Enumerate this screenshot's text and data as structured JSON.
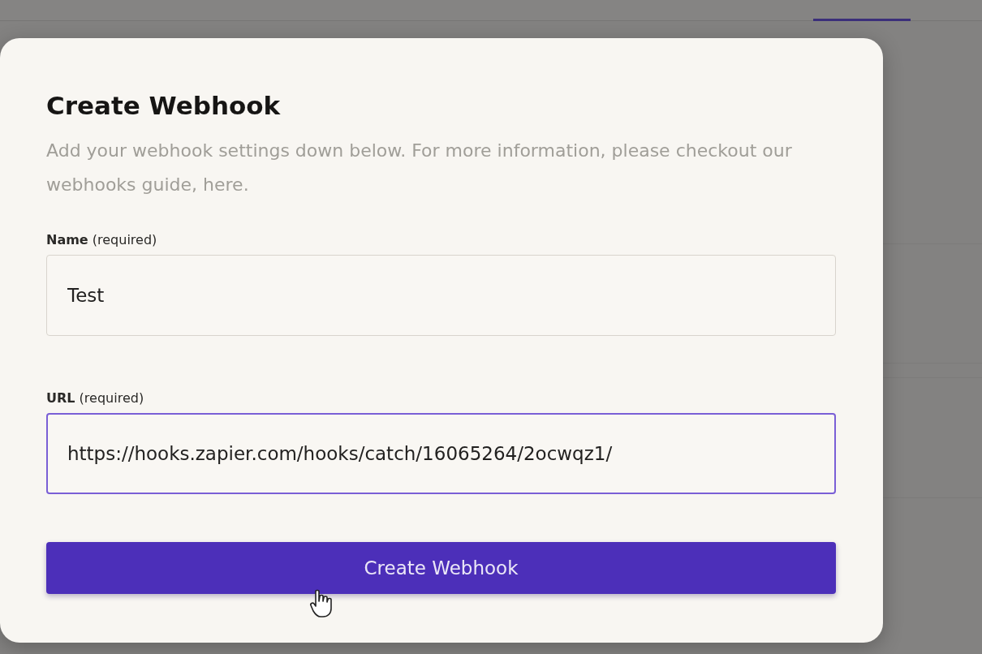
{
  "dialog": {
    "title": "Create Webhook",
    "description": "Add your webhook settings down below. For more information, please checkout our webhooks guide, here.",
    "fields": [
      {
        "label": "**Name** (required)",
        "value": "Test",
        "focused": false
      },
      {
        "label": "**URL** (required)",
        "value": "https://hooks.zapier.com/hooks/catch/16065264/2ocwqz1/",
        "focused": true
      }
    ],
    "submit_button": {
      "label": "Create Webhook"
    }
  }
}
